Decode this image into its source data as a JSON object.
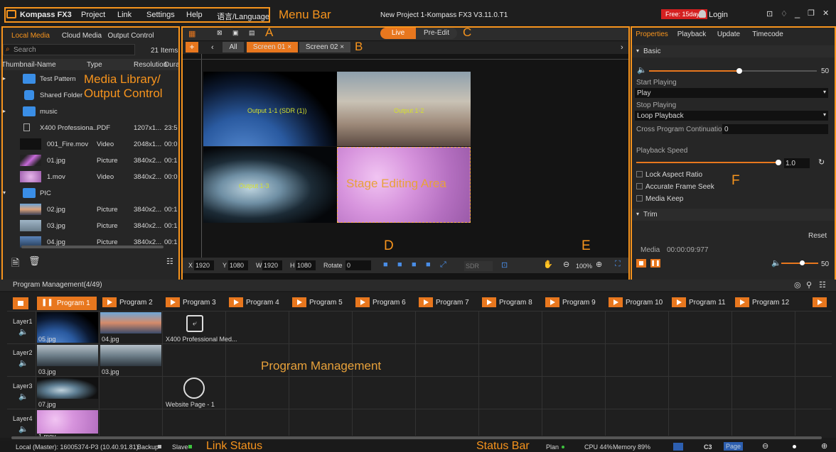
{
  "menu": {
    "app_name": "Kompass FX3",
    "items": [
      "Project",
      "Link",
      "Settings",
      "Help",
      "语言/Language"
    ],
    "window_title": "New Project 1-Kompass FX3  V3.11.0.T1",
    "trial_badge": "Free: 15days",
    "login": "Login"
  },
  "annotations": {
    "menu_bar": "Menu Bar",
    "media_library": "Media Library/",
    "output_control": "Output Control",
    "a": "A",
    "b": "B",
    "c": "C",
    "d": "D",
    "e": "E",
    "f": "F",
    "stage": "Stage Editing Area",
    "program_management": "Program Management",
    "link_status": "Link Status",
    "status_bar": "Status Bar"
  },
  "left": {
    "tabs": [
      "Local Media",
      "Cloud Media",
      "Output Control"
    ],
    "search_placeholder": "Search",
    "items_count": "21 Items",
    "columns": [
      "Thumbnail-Name",
      "Type",
      "Resolution",
      "Dura"
    ],
    "rows": [
      {
        "name": "Test Pattern",
        "type": "",
        "res": "",
        "dur": "",
        "kind": "folder",
        "expand": "▸"
      },
      {
        "name": "Shared Folder",
        "type": "",
        "res": "",
        "dur": "",
        "kind": "shared",
        "expand": ""
      },
      {
        "name": "music",
        "type": "",
        "res": "",
        "dur": "",
        "kind": "folder",
        "expand": "▸"
      },
      {
        "name": "X400 Professiona...",
        "type": "PDF",
        "res": "1207x1...",
        "dur": "23:5",
        "kind": "pdf",
        "expand": ""
      },
      {
        "name": "001_Fire.mov",
        "type": "Video",
        "res": "2048x1...",
        "dur": "00:0",
        "kind": "dark",
        "expand": ""
      },
      {
        "name": "01.jpg",
        "type": "Picture",
        "res": "3840x2...",
        "dur": "00:1",
        "kind": "pink",
        "expand": ""
      },
      {
        "name": "1.mov",
        "type": "Video",
        "res": "3840x2...",
        "dur": "00:0",
        "kind": "pink2",
        "expand": ""
      },
      {
        "name": "PIC",
        "type": "",
        "res": "",
        "dur": "",
        "kind": "folder",
        "expand": "▾"
      },
      {
        "name": "02.jpg",
        "type": "Picture",
        "res": "3840x2...",
        "dur": "00:1",
        "kind": "land",
        "expand": ""
      },
      {
        "name": "03.jpg",
        "type": "Picture",
        "res": "3840x2...",
        "dur": "00:1",
        "kind": "sky",
        "expand": ""
      },
      {
        "name": "04.jpg",
        "type": "Picture",
        "res": "3840x2...",
        "dur": "00:1",
        "kind": "sea",
        "expand": ""
      }
    ]
  },
  "stage": {
    "mode_live": "Live",
    "mode_preedit": "Pre-Edit",
    "screen_tabs": [
      "All",
      "Screen 01",
      "Screen 02"
    ],
    "output_label_1": "Output 1-1 (SDR (1))",
    "output_label_2": "Output 1-2",
    "output_label_3": "Output 1-3",
    "x": "1920",
    "y": "1080",
    "w": "1920",
    "h": "1080",
    "rotate": "0",
    "labels": {
      "x": "X",
      "y": "Y",
      "w": "W",
      "h": "H",
      "rotate": "Rotate"
    },
    "sdr": "SDR",
    "zoom": "100%"
  },
  "props": {
    "tabs": [
      "Properties",
      "Playback",
      "Update",
      "Timecode"
    ],
    "basic": "Basic",
    "volume": "50",
    "volume_level": 0.54,
    "start_playing_label": "Start Playing",
    "start_playing": "Play",
    "stop_playing_label": "Stop Playing",
    "stop_playing": "Loop Playback",
    "cross_label": "Cross Program Continuation",
    "cross_value": "0",
    "speed_label": "Playback Speed",
    "speed_value": "1.0",
    "checks": [
      "Lock Aspect Ratio",
      "Accurate Frame Seek",
      "Media Keep"
    ],
    "trim": "Trim",
    "reset": "Reset",
    "media_label": "Media",
    "media_time": "00:00:09:977",
    "bottom_volume": "50"
  },
  "programs": {
    "header": "Program Management(4/49)",
    "names": [
      "Program 1",
      "Program 2",
      "Program 3",
      "Program 4",
      "Program 5",
      "Program 6",
      "Program 7",
      "Program 8",
      "Program 9",
      "Program 10",
      "Program 11",
      "Program 12"
    ],
    "layers": [
      "Layer1",
      "Layer2",
      "Layer3",
      "Layer4"
    ],
    "cells": {
      "l1": [
        "05.jpg",
        "04.jpg",
        "X400 Professional Med..."
      ],
      "l2": [
        "03.jpg",
        "03.jpg"
      ],
      "l3": [
        "07.jpg",
        "Website Page - 1"
      ],
      "l4": [
        "1.mov"
      ]
    }
  },
  "status": {
    "local": "Local (Master): 16005374-P3 (10.40.91.81)",
    "backup": "Backup",
    "slave": "Slave",
    "plan": "Plan",
    "cpu": "CPU 44%",
    "memory": "Memory 89%",
    "c3": "C3",
    "page": "Page"
  }
}
